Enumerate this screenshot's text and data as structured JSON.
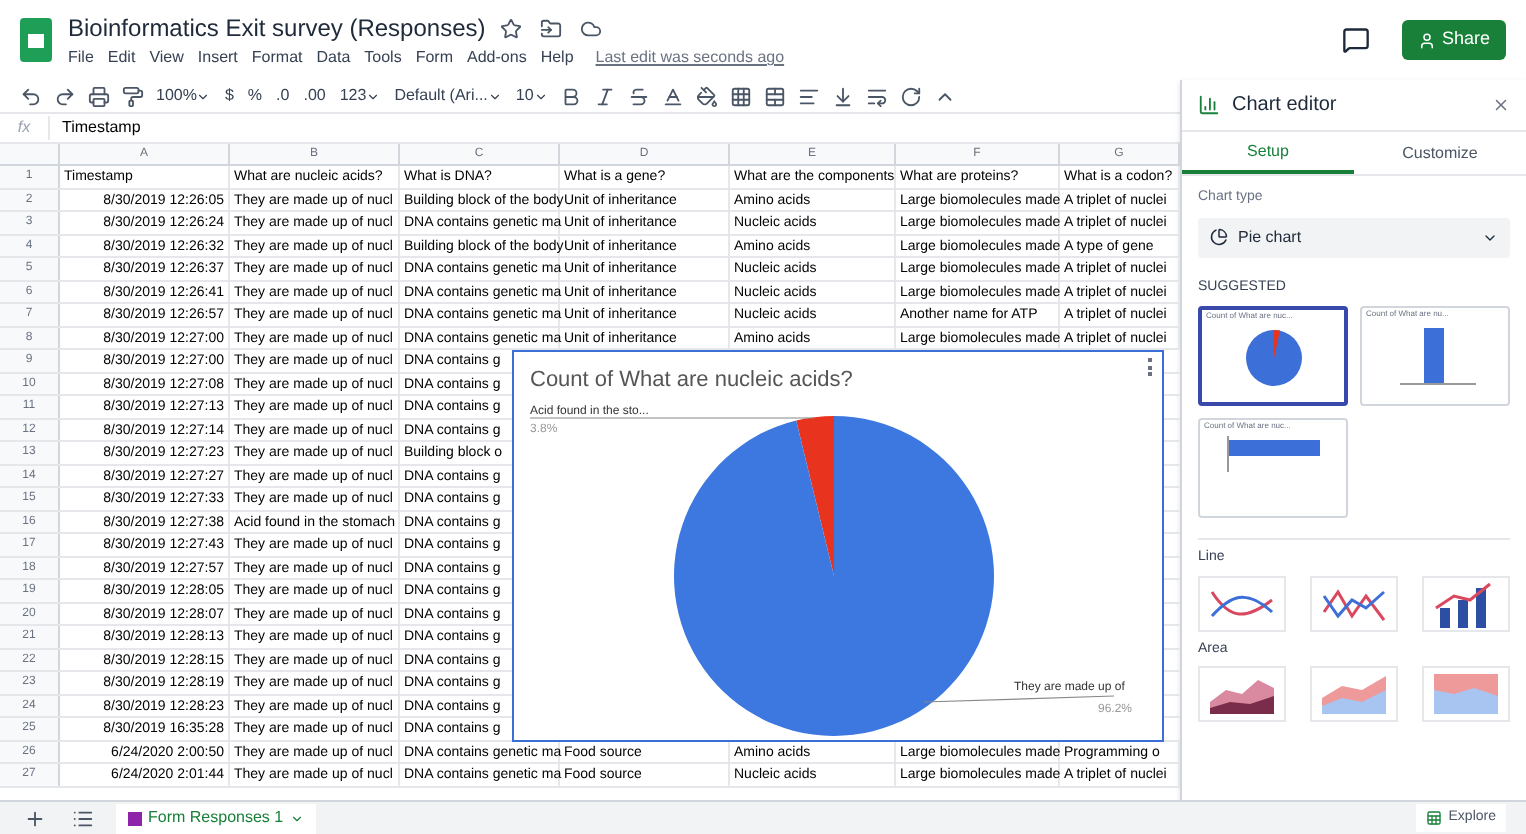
{
  "document": {
    "title": "Bioinformatics Exit survey (Responses)",
    "share_button": "Share"
  },
  "menu": [
    "File",
    "Edit",
    "View",
    "Insert",
    "Format",
    "Data",
    "Tools",
    "Form",
    "Add-ons",
    "Help"
  ],
  "last_edit": "Last edit was seconds ago",
  "toolbar": {
    "zoom": "100%",
    "currency": "$",
    "percent": "%",
    "decimal_decrease": ".0",
    "decimal_increase": ".00",
    "number_format": "123",
    "font": "Default (Ari...",
    "font_size": "10"
  },
  "formula_bar": {
    "label": "fx",
    "value": "Timestamp"
  },
  "sheet": {
    "columns": [
      "A",
      "B",
      "C",
      "D",
      "E",
      "F",
      "G"
    ],
    "rows": [
      {
        "number": "1",
        "cells": [
          "Timestamp",
          "What are nucleic acids?",
          "What is DNA?",
          "What is a gene?",
          "What are the components",
          "What are proteins?",
          "What is a codon?"
        ]
      },
      {
        "number": "2",
        "cells": [
          "8/30/2019 12:26:05",
          "They are made up of nucl",
          "Building block of the body",
          "Unit of inheritance",
          "Amino acids",
          "Large biomolecules made",
          "A triplet of nuclei"
        ]
      },
      {
        "number": "3",
        "cells": [
          "8/30/2019 12:26:24",
          "They are made up of nucl",
          "DNA contains genetic ma",
          "Unit of inheritance",
          "Nucleic acids",
          "Large biomolecules made",
          "A triplet of nuclei"
        ]
      },
      {
        "number": "4",
        "cells": [
          "8/30/2019 12:26:32",
          "They are made up of nucl",
          "Building block of the body",
          "Unit of inheritance",
          "Amino acids",
          "Large biomolecules made",
          "A type of gene"
        ]
      },
      {
        "number": "5",
        "cells": [
          "8/30/2019 12:26:37",
          "They are made up of nucl",
          "DNA contains genetic ma",
          "Unit of inheritance",
          "Nucleic acids",
          "Large biomolecules made",
          "A triplet of nuclei"
        ]
      },
      {
        "number": "6",
        "cells": [
          "8/30/2019 12:26:41",
          "They are made up of nucl",
          "DNA contains genetic ma",
          "Unit of inheritance",
          "Nucleic acids",
          "Large biomolecules made",
          "A triplet of nuclei"
        ]
      },
      {
        "number": "7",
        "cells": [
          "8/30/2019 12:26:57",
          "They are made up of nucl",
          "DNA contains genetic ma",
          "Unit of inheritance",
          "Nucleic acids",
          "Another name for ATP",
          "A triplet of nuclei"
        ]
      },
      {
        "number": "8",
        "cells": [
          "8/30/2019 12:27:00",
          "They are made up of nucl",
          "DNA contains genetic ma",
          "Unit of inheritance",
          "Amino acids",
          "Large biomolecules made",
          "A triplet of nuclei"
        ]
      },
      {
        "number": "9",
        "cells": [
          "8/30/2019 12:27:00",
          "They are made up of nucl",
          "DNA contains g"
        ]
      },
      {
        "number": "10",
        "cells": [
          "8/30/2019 12:27:08",
          "They are made up of nucl",
          "DNA contains g"
        ]
      },
      {
        "number": "11",
        "cells": [
          "8/30/2019 12:27:13",
          "They are made up of nucl",
          "DNA contains g"
        ]
      },
      {
        "number": "12",
        "cells": [
          "8/30/2019 12:27:14",
          "They are made up of nucl",
          "DNA contains g"
        ]
      },
      {
        "number": "13",
        "cells": [
          "8/30/2019 12:27:23",
          "They are made up of nucl",
          "Building block o"
        ]
      },
      {
        "number": "14",
        "cells": [
          "8/30/2019 12:27:27",
          "They are made up of nucl",
          "DNA contains g"
        ]
      },
      {
        "number": "15",
        "cells": [
          "8/30/2019 12:27:33",
          "They are made up of nucl",
          "DNA contains g"
        ]
      },
      {
        "number": "16",
        "cells": [
          "8/30/2019 12:27:38",
          "Acid found in the stomach",
          "DNA contains g"
        ]
      },
      {
        "number": "17",
        "cells": [
          "8/30/2019 12:27:43",
          "They are made up of nucl",
          "DNA contains g"
        ]
      },
      {
        "number": "18",
        "cells": [
          "8/30/2019 12:27:57",
          "They are made up of nucl",
          "DNA contains g"
        ]
      },
      {
        "number": "19",
        "cells": [
          "8/30/2019 12:28:05",
          "They are made up of nucl",
          "DNA contains g"
        ]
      },
      {
        "number": "20",
        "cells": [
          "8/30/2019 12:28:07",
          "They are made up of nucl",
          "DNA contains g"
        ]
      },
      {
        "number": "21",
        "cells": [
          "8/30/2019 12:28:13",
          "They are made up of nucl",
          "DNA contains g"
        ]
      },
      {
        "number": "22",
        "cells": [
          "8/30/2019 12:28:15",
          "They are made up of nucl",
          "DNA contains g"
        ]
      },
      {
        "number": "23",
        "cells": [
          "8/30/2019 12:28:19",
          "They are made up of nucl",
          "DNA contains g"
        ]
      },
      {
        "number": "24",
        "cells": [
          "8/30/2019 12:28:23",
          "They are made up of nucl",
          "DNA contains g"
        ]
      },
      {
        "number": "25",
        "cells": [
          "8/30/2019 16:35:28",
          "They are made up of nucl",
          "DNA contains g"
        ]
      },
      {
        "number": "26",
        "cells": [
          "6/24/2020 2:00:50",
          "They are made up of nucl",
          "DNA contains genetic ma",
          "Food source",
          "Amino acids",
          "Large biomolecules made",
          "Programming o"
        ]
      },
      {
        "number": "27",
        "cells": [
          "6/24/2020 2:01:44",
          "They are made up of nucl",
          "DNA contains genetic ma",
          "Food source",
          "Nucleic acids",
          "Large biomolecules made",
          "A triplet of nuclei"
        ]
      }
    ]
  },
  "chart": {
    "chart_data": {
      "type": "pie",
      "title": "Count of What are nucleic acids?",
      "categories": [
        "Acid found in the sto...",
        "They are made up of"
      ],
      "values": [
        3.8,
        96.2
      ],
      "colors": [
        "#e8331e",
        "#3d78e0"
      ],
      "value_labels": [
        "3.8%",
        "96.2%"
      ]
    }
  },
  "chart_editor": {
    "title": "Chart editor",
    "tabs": [
      {
        "label": "Setup",
        "selected": true
      },
      {
        "label": "Customize",
        "selected": false
      }
    ],
    "chart_type_label": "Chart type",
    "chart_type": "Pie chart",
    "suggested": {
      "label": "SUGGESTED",
      "thumbnails": [
        {
          "kind": "pie",
          "title": "Count of What are nuc...",
          "selected": true
        },
        {
          "kind": "column",
          "title": "Count of What are nu...",
          "selected": false
        },
        {
          "kind": "bar",
          "title": "Count of What are nuc...",
          "selected": false
        }
      ]
    },
    "groups": [
      {
        "label": "Line",
        "thumbnails": [
          {
            "kind": "line"
          },
          {
            "kind": "line-points"
          },
          {
            "kind": "combo"
          }
        ]
      },
      {
        "label": "Area",
        "thumbnails": [
          {
            "kind": "area"
          },
          {
            "kind": "stacked-area"
          },
          {
            "kind": "full-area"
          }
        ]
      }
    ]
  },
  "sheet_tabs": [
    {
      "label": "Form Responses 1",
      "selected": true
    }
  ],
  "explore_button": "Explore"
}
